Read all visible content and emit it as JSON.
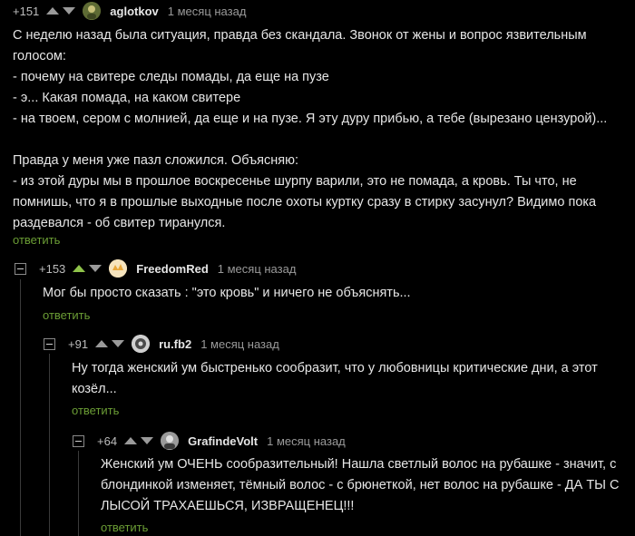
{
  "comments": [
    {
      "rating": "+151",
      "username": "aglotkov",
      "time": "1 месяц назад",
      "text": "С неделю назад была ситуация, правда без скандала. Звонок от жены и вопрос язвительным\nголосом:\n- почему на свитере следы помады, да еще на пузе\n- э... Какая помада, на каком свитере\n- на твоем, сером с молнией, да еще и на пузе. Я эту дуру прибью, а тебе (вырезано цензурой)...\n\nПравда у меня уже пазл сложился. Объясняю:\n- из этой дуры мы в прошлое воскресенье шурпу варили, это не помада, а кровь. Ты что, не\nпомнишь, что я в прошлые выходные после охоты куртку сразу в стирку засунул? Видимо пока\nраздевался - об свитер тиранулся.",
      "reply": "ответить"
    },
    {
      "rating": "+153",
      "username": "FreedomRed",
      "time": "1 месяц назад",
      "text": "Мог бы просто сказать : \"это кровь\" и ничего не объяснять...",
      "reply": "ответить"
    },
    {
      "rating": "+91",
      "username": "ru.fb2",
      "time": "1 месяц назад",
      "text": "Ну тогда женский ум быстренько сообразит, что у любовницы критические дни, а этот\nкозёл...",
      "reply": "ответить"
    },
    {
      "rating": "+64",
      "username": "GrafindeVolt",
      "time": "1 месяц назад",
      "text": "Женский ум ОЧЕНЬ сообразительный! Нашла светлый волос на рубашке - значит, с\nблондинкой изменяет, тёмный волос - с брюнеткой, нет волос на рубашке - ДА ТЫ С\nЛЫСОЙ ТРАХАЕШЬСЯ, ИЗВРАЩЕНЕЦ!!!",
      "reply": "ответить"
    }
  ],
  "colors": {
    "background": "#000000",
    "reply_link": "#6b9d35",
    "upvote_active": "#8fc34a"
  }
}
